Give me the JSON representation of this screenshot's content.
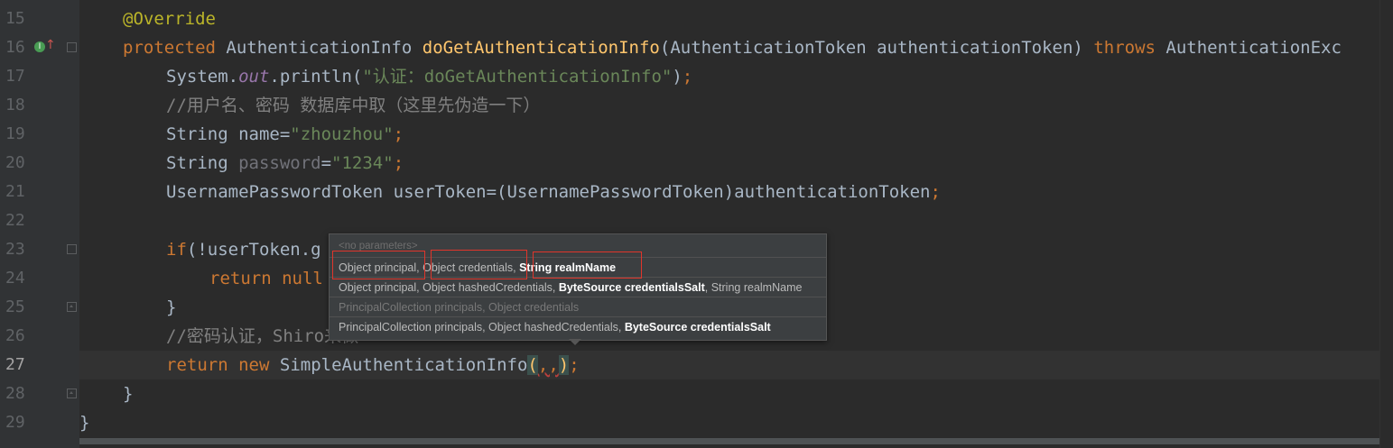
{
  "editor": {
    "language": "java",
    "current_line": "27",
    "lines": [
      {
        "num": "15"
      },
      {
        "num": "16"
      },
      {
        "num": "17"
      },
      {
        "num": "18"
      },
      {
        "num": "19"
      },
      {
        "num": "20"
      },
      {
        "num": "21"
      },
      {
        "num": "22"
      },
      {
        "num": "23"
      },
      {
        "num": "24"
      },
      {
        "num": "25"
      },
      {
        "num": "26"
      },
      {
        "num": "27"
      },
      {
        "num": "28"
      },
      {
        "num": "29"
      }
    ],
    "tokens": {
      "l15_annotation": "@Override",
      "l16_protected": "protected",
      "l16_type": "AuthenticationInfo",
      "l16_method": "doGetAuthenticationInfo",
      "l16_params": "(AuthenticationToken authenticationToken)",
      "l16_throws": "throws",
      "l16_exception": "AuthenticationExc",
      "l17_system": "System.",
      "l17_out": "out",
      "l17_println": ".println(",
      "l17_string": "\"认证：doGetAuthenticationInfo\"",
      "l17_end": ")",
      "l18_comment": "//用户名、密码 数据库中取（这里先伪造一下）",
      "l19_type": "String name=",
      "l19_string": "\"zhouzhou\"",
      "l20_type": "String ",
      "l20_var": "password",
      "l20_eq": "=",
      "l20_string": "\"1234\"",
      "l21_code": "UsernamePasswordToken userToken=(UsernamePasswordToken)authenticationToken",
      "l23_if": "if",
      "l23_code": "(!userToken.g",
      "l24_return": "return",
      "l24_null": "null",
      "l25_brace": "}",
      "l26_comment": "//密码认证，Shiro来做",
      "l27_return": "return",
      "l27_new": "new",
      "l27_class": "SimpleAuthenticationInfo",
      "l27_open": "(",
      "l27_commas": ",,",
      "l27_close": ")",
      "l28_brace": "}",
      "l29_brace": "}",
      "semicolon": ";"
    }
  },
  "gutter_icons": {
    "override": "override-implementing-icon",
    "override_glyph": "I",
    "arrow": "up-arrow-icon",
    "arrow_glyph": "↑"
  },
  "parameter_info_popup": {
    "header": "<no parameters>",
    "rows": [
      {
        "normal_a": "Object principal, Object credentials, ",
        "bold": "String realmName",
        "normal_b": ""
      },
      {
        "normal_a": "Object principal, Object hashedCredentials, ",
        "bold": "ByteSource credentialsSalt",
        "normal_b": ", String realmName"
      },
      {
        "normal_a": "PrincipalCollection principals, Object credentials",
        "bold": "",
        "normal_b": ""
      },
      {
        "normal_a": "PrincipalCollection principals, Object hashedCredentials, ",
        "bold": "ByteSource credentialsSalt",
        "normal_b": ""
      }
    ]
  },
  "colors": {
    "background": "#2b2b2b",
    "keyword": "#cc7832",
    "string": "#6a8759",
    "method": "#ffc66d",
    "comment": "#808080",
    "annotation": "#bbb529",
    "highlight_box": "#e0352b"
  }
}
